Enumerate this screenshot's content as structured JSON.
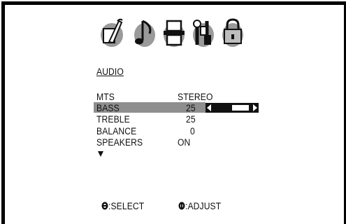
{
  "menu_icons": [
    {
      "name": "picture-icon"
    },
    {
      "name": "audio-note-icon"
    },
    {
      "name": "setup-tv-icon"
    },
    {
      "name": "features-tools-icon"
    },
    {
      "name": "lock-icon"
    }
  ],
  "section_title": "AUDIO",
  "rows": [
    {
      "label": "MTS",
      "value": "STEREO"
    },
    {
      "label": "BASS",
      "value": "25"
    },
    {
      "label": "TREBLE",
      "value": "25"
    },
    {
      "label": "BALANCE",
      "value": "0"
    },
    {
      "label": "SPEAKERS",
      "value": "ON"
    }
  ],
  "selected_row": "BASS",
  "bass_slider": {
    "level": 0.5
  },
  "more_indicator": "▼",
  "hints": {
    "select": ":SELECT",
    "adjust": ":ADJUST"
  },
  "colors": {
    "highlight": "#8e8e8e",
    "icon_gray": "#9a9a9a"
  }
}
